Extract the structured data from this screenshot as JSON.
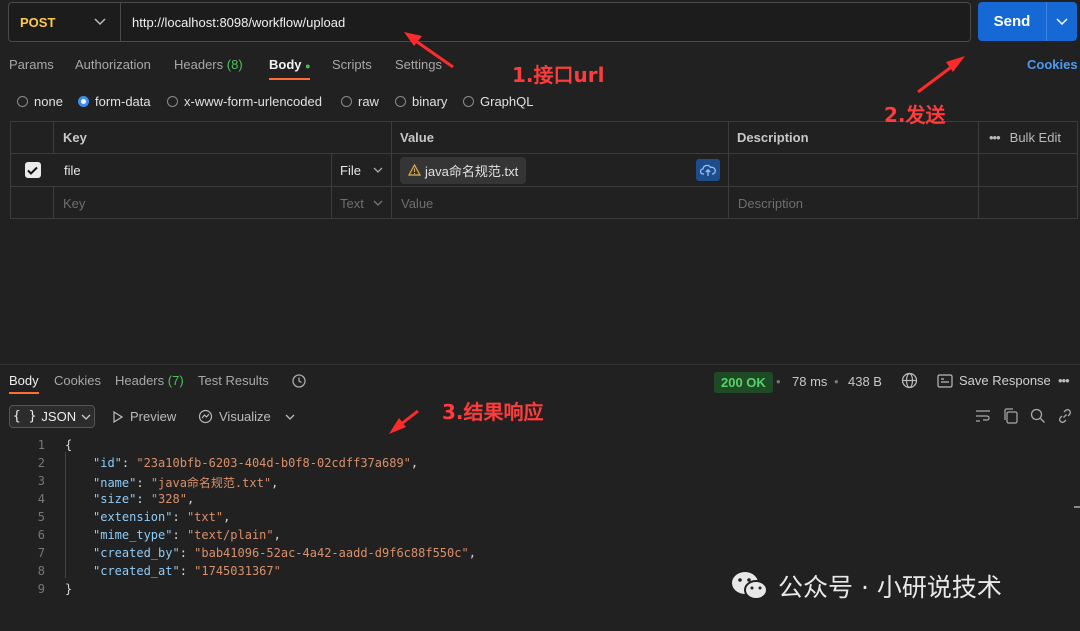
{
  "request": {
    "method": "POST",
    "url": "http://localhost:8098/workflow/upload",
    "send_label": "Send",
    "cookies_label": "Cookies"
  },
  "req_tabs": {
    "params": "Params",
    "authorization": "Authorization",
    "headers": "Headers",
    "headers_count": "(8)",
    "body": "Body",
    "scripts": "Scripts",
    "settings": "Settings"
  },
  "body_types": {
    "none": "none",
    "form_data": "form-data",
    "urlencoded": "x-www-form-urlencoded",
    "raw": "raw",
    "binary": "binary",
    "graphql": "GraphQL",
    "selected": "form-data"
  },
  "form_table": {
    "col_key": "Key",
    "col_value": "Value",
    "col_description": "Description",
    "bulk_edit": "Bulk Edit",
    "row_key": "file",
    "row_type": "File",
    "row_file": "java命名规范.txt",
    "placeholder_key": "Key",
    "placeholder_type": "Text",
    "placeholder_value": "Value",
    "placeholder_description": "Description"
  },
  "response_tabs": {
    "body": "Body",
    "cookies": "Cookies",
    "headers": "Headers",
    "headers_count": "(7)",
    "test_results": "Test Results"
  },
  "response_meta": {
    "status": "200 OK",
    "time": "78 ms",
    "size": "438 B",
    "save_response": "Save Response",
    "status_color": "#56d364"
  },
  "response_view": {
    "format": "JSON",
    "preview": "Preview",
    "visualize": "Visualize"
  },
  "response_body": {
    "open": "{",
    "close": "}",
    "fields": [
      {
        "key": "\"id\"",
        "value": "\"23a10bfb-6203-404d-b0f8-02cdff37a689\"",
        "comma": ","
      },
      {
        "key": "\"name\"",
        "value": "\"java命名规范.txt\"",
        "comma": ","
      },
      {
        "key": "\"size\"",
        "value": "\"328\"",
        "comma": ","
      },
      {
        "key": "\"extension\"",
        "value": "\"txt\"",
        "comma": ","
      },
      {
        "key": "\"mime_type\"",
        "value": "\"text/plain\"",
        "comma": ","
      },
      {
        "key": "\"created_by\"",
        "value": "\"bab41096-52ac-4a42-aadd-d9f6c88f550c\"",
        "comma": ","
      },
      {
        "key": "\"created_at\"",
        "value": "\"1745031367\"",
        "comma": ""
      }
    ],
    "line_numbers": [
      "1",
      "2",
      "3",
      "4",
      "5",
      "6",
      "7",
      "8",
      "9"
    ]
  },
  "annotations": {
    "step1": "1.接口url",
    "step2": "2.发送",
    "step3": "3.结果响应",
    "color": "#ff3b3b"
  },
  "watermark": "公众号 · 小研说技术"
}
